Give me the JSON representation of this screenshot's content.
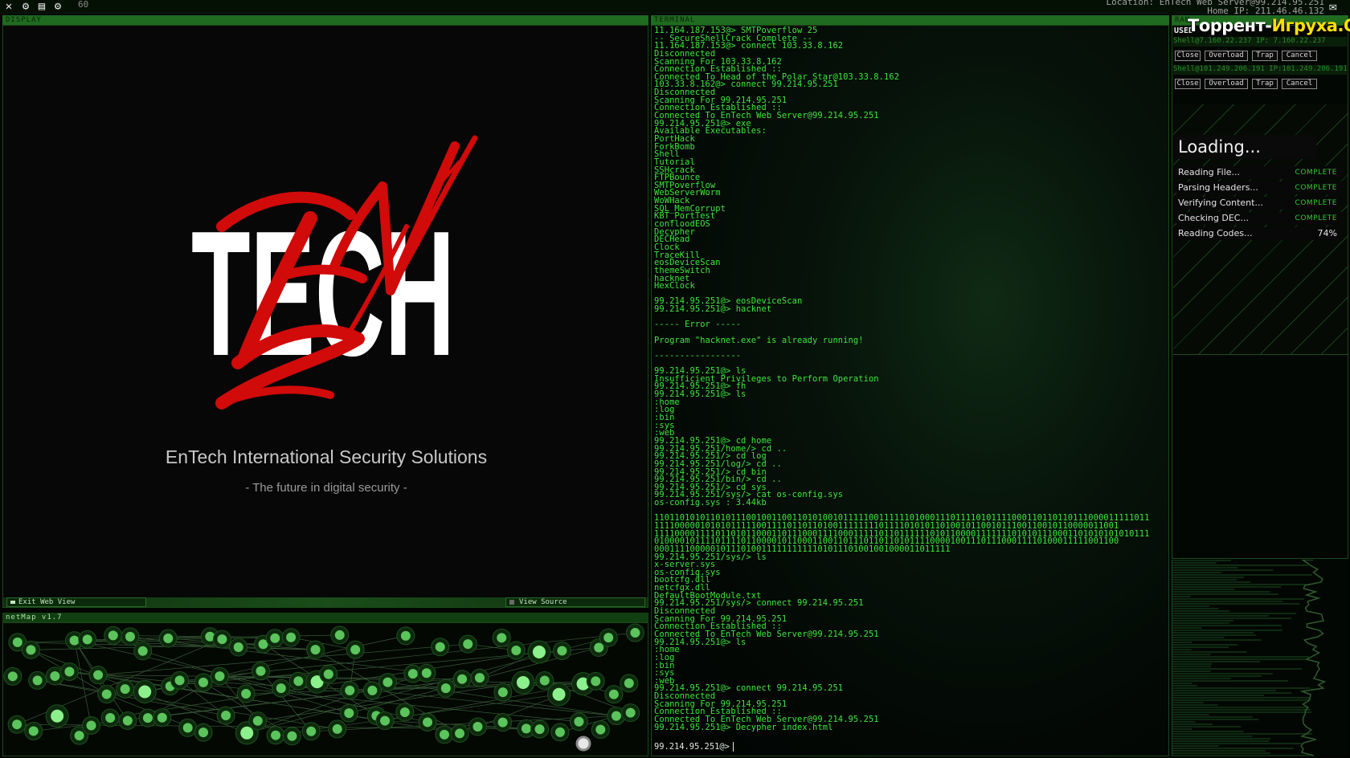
{
  "topbar": {
    "icons": [
      "close-icon",
      "gear-icon",
      "save-icon",
      "settings-icon"
    ],
    "fps": "60",
    "location_line1": "Location: EnTech Web Server@99.214.95.251",
    "location_line2": "Home IP: 211.46.46.132",
    "mail_icon": "mail-icon"
  },
  "display": {
    "header": "DISPLAY",
    "logo_text": "TECH",
    "company_name": "EnTech International Security Solutions",
    "tagline": "- The future in digital security -",
    "exit_button": "Exit Web View",
    "source_button": "View Source"
  },
  "netmap": {
    "header": "netMap v1.7"
  },
  "terminal": {
    "header": "TERMINAL",
    "lines": [
      "11.164.187.153@> SMTPoverflow 25",
      "-- SecureShellCrack Complete --",
      "11.164.187.153@> connect 103.33.8.162",
      "Disconnected",
      "Scanning For 103.33.8.162",
      "Connection Established ::",
      "Connected To Head of the Polar Star@103.33.8.162",
      "103.33.8.162@> connect 99.214.95.251",
      "Disconnected",
      "Scanning For 99.214.95.251",
      "Connection Established ::",
      "Connected To EnTech Web Server@99.214.95.251",
      "99.214.95.251@> exe",
      "Available Executables:",
      "PortHack",
      "ForkBomb",
      "Shell",
      "Tutorial",
      "SSHcrack",
      "FTPBounce",
      "SMTPoverflow",
      "WebServerWorm",
      "WoWHack",
      "SQL_MemCorrupt",
      "KBT_PortTest",
      "confloodEOS",
      "Decypher",
      "DECHead",
      "Clock",
      "TraceKill",
      "eosDeviceScan",
      "themeSwitch",
      "hacknet",
      "HexClock",
      "",
      "99.214.95.251@> eosDeviceScan",
      "99.214.95.251@> hacknet",
      "",
      "----- Error -----",
      "",
      "Program \"hacknet.exe\" is already running!",
      "",
      "-----------------",
      "",
      "99.214.95.251@> ls",
      "Insufficient Privileges to Perform Operation",
      "99.214.95.251@> fh",
      "99.214.95.251@> ls",
      ":home",
      ":log",
      ":bin",
      ":sys",
      ":web",
      "99.214.95.251@> cd home",
      "99.214.95.251/home/> cd ..",
      "99.214.95.251/> cd log",
      "99.214.95.251/log/> cd ..",
      "99.214.95.251/> cd bin",
      "99.214.95.251/bin/> cd ..",
      "99.214.95.251/> cd sys",
      "99.214.95.251/sys/> cat os-config.sys",
      "os-config.sys : 3.44kb",
      "",
      "1101101010110101110010011001101010010111110011111101000111011110101111000110110110111000011111011",
      "1111000001010101111100111101101101001111111101111010101101001011001011100110010110000011001",
      "1111000011110110101100011011100011110001111101101111110101100001111111010101110001101010101010111",
      "0100001011110111101100001011000110011011101101101011110000100111011100011110100011111001100",
      "0001111000001011101001111111111101011101001001000011011111",
      "99.214.95.251/sys/> ls",
      "x-server.sys",
      "os-config.sys",
      "bootcfg.dll",
      "netcfgx.dll",
      "DefaultBootModule.txt",
      "99.214.95.251/sys/> connect 99.214.95.251",
      "Disconnected",
      "Scanning For 99.214.95.251",
      "Connection Established ::",
      "Connected To EnTech Web Server@99.214.95.251",
      "99.214.95.251@> ls",
      ":home",
      ":log",
      ":bin",
      ":sys",
      ":web",
      "99.214.95.251@> connect 99.214.95.251",
      "Disconnected",
      "Scanning For 99.214.95.251",
      "Connection Established ::",
      "Connected To EnTech Web Server@99.214.95.251",
      "99.214.95.251@> Decypher index.html"
    ],
    "prompt": "99.214.95.251@>"
  },
  "ram": {
    "header": "RAM",
    "used_label": "USED",
    "processes": [
      {
        "title": "Shell@7.160.22.237      IP: 7.160.22.237",
        "buttons": [
          "Close",
          "Overload",
          "Trap",
          "Cancel"
        ]
      },
      {
        "title": "Shell@101.249.206.191   IP:101.249.206.191",
        "buttons": [
          "Close",
          "Overload",
          "Trap",
          "Cancel"
        ]
      }
    ],
    "loader": {
      "title": "Loading...",
      "rows": [
        {
          "label": "Reading File...",
          "status": "COMPLETE"
        },
        {
          "label": "Parsing Headers...",
          "status": "COMPLETE"
        },
        {
          "label": "Verifying Content...",
          "status": "COMPLETE"
        },
        {
          "label": "Checking DEC...",
          "status": "COMPLETE"
        },
        {
          "label": "Reading Codes...",
          "status": "74%"
        }
      ]
    }
  },
  "watermark": {
    "part1": "Торрент-",
    "part2": "Игруха.Орг"
  },
  "colors": {
    "terminal_text": "#3ee63e",
    "panel_header": "#1f6b1f",
    "logo_red": "#d10a0a",
    "node_green": "#6fd86f"
  }
}
